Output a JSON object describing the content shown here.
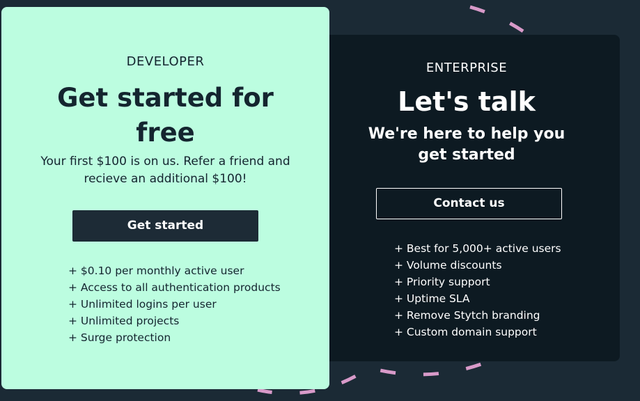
{
  "developer": {
    "tier_label": "DEVELOPER",
    "headline": "Get started for free",
    "subtext": "Your first $100 is on us. Refer a friend and recieve an additional $100!",
    "button_label": "Get started",
    "features": [
      "+ $0.10 per monthly active user",
      "+ Access to all authentication products",
      "+ Unlimited logins per user",
      "+ Unlimited projects",
      "+ Surge protection"
    ]
  },
  "enterprise": {
    "tier_label": "ENTERPRISE",
    "headline": "Let's talk",
    "subhead": "We're here to help you get started",
    "button_label": "Contact us",
    "features": [
      "+ Best for 5,000+ active users",
      "+ Volume discounts",
      "+ Priority support",
      "+ Uptime SLA",
      "+ Remove Stytch branding",
      "+ Custom domain support"
    ]
  },
  "colors": {
    "page_background": "#1b2a35",
    "developer_card": "#bcfde0",
    "enterprise_card": "#0d1a22",
    "dark_button": "#1d2b36",
    "decorative_dash": "#d89ac9"
  }
}
